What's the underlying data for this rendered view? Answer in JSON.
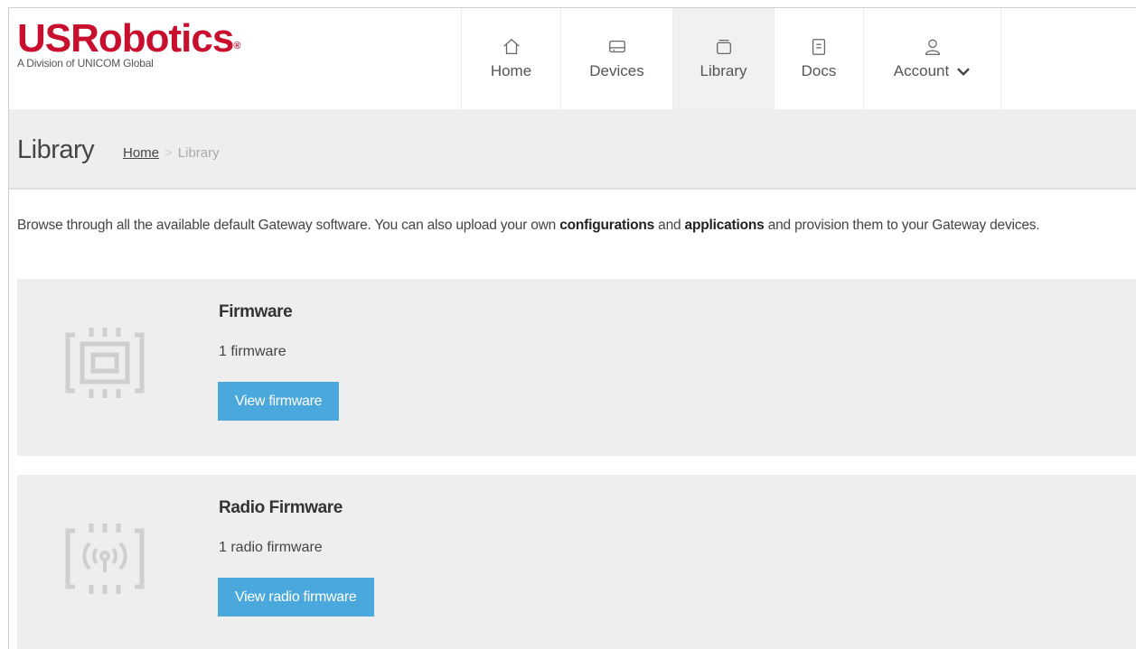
{
  "brand": {
    "name": "USRobotics",
    "registered": "®",
    "tagline": "A Division of UNICOM Global",
    "color": "#c8102e"
  },
  "nav": {
    "items": [
      {
        "label": "Home",
        "icon": "home-icon"
      },
      {
        "label": "Devices",
        "icon": "devices-icon"
      },
      {
        "label": "Library",
        "icon": "library-icon",
        "active": true
      },
      {
        "label": "Docs",
        "icon": "docs-icon"
      },
      {
        "label": "Account",
        "icon": "user-icon"
      }
    ]
  },
  "titlebar": {
    "title": "Library",
    "breadcrumb": {
      "home": "Home",
      "separator": ">",
      "current": "Library"
    }
  },
  "intro": {
    "text_before": "Browse through all the available default Gateway software. You can also upload your own ",
    "bold1": "configurations",
    "text_mid": " and ",
    "bold2": "applications",
    "text_after": " and provision them to your Gateway devices."
  },
  "cards": [
    {
      "title": "Firmware",
      "count": "1 firmware",
      "button": "View firmware",
      "icon": "chip-icon"
    },
    {
      "title": "Radio Firmware",
      "count": "1 radio firmware",
      "button": "View radio firmware",
      "icon": "radio-chip-icon"
    }
  ],
  "colors": {
    "accent": "#4aa8dd",
    "panel": "#eeeeee"
  }
}
